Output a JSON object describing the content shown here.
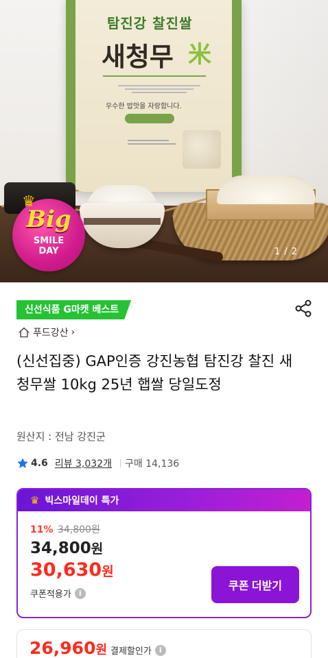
{
  "hero": {
    "bag_brand_line1": "탐진강 찰진쌀",
    "bag_brand_line2": "새청무",
    "bag_brand_mark": "米",
    "bag_slogan": "우수한 밥맛을 자랑합니다.",
    "badge_big": "Big",
    "badge_smile": "SMILE",
    "badge_day": "DAY",
    "pager": "1 / 2"
  },
  "product": {
    "tag": "신선식품 G마켓 베스트",
    "store": "푸드강산",
    "store_chevron": "›",
    "title": "(신선집중) GAP인증 강진농협 탐진강 찰진 새청무쌀 10kg 25년 햅쌀 당일도정",
    "origin": "원산지 : 전남 강진군",
    "rating": "4.6",
    "reviews": "리뷰 3,032개",
    "buy_count": "구매 14,136",
    "icons": {
      "share": "share-icon",
      "store": "home-icon",
      "rating": "star-icon"
    }
  },
  "promo": {
    "header": "빅스마일데이 특가",
    "discount_rate": "11%",
    "original_price": "34,800원",
    "price": "34,800",
    "price_unit": "원",
    "sale_price": "30,630",
    "sale_unit": "원",
    "coupon_label": "쿠폰적용가",
    "coupon_button": "쿠폰 더받기",
    "colors": {
      "accent": "#8b14d6",
      "sale": "#ff2a1c",
      "tag": "#25c233"
    }
  },
  "payment": {
    "price": "26,960",
    "unit": "원",
    "label": "결제할인가"
  }
}
